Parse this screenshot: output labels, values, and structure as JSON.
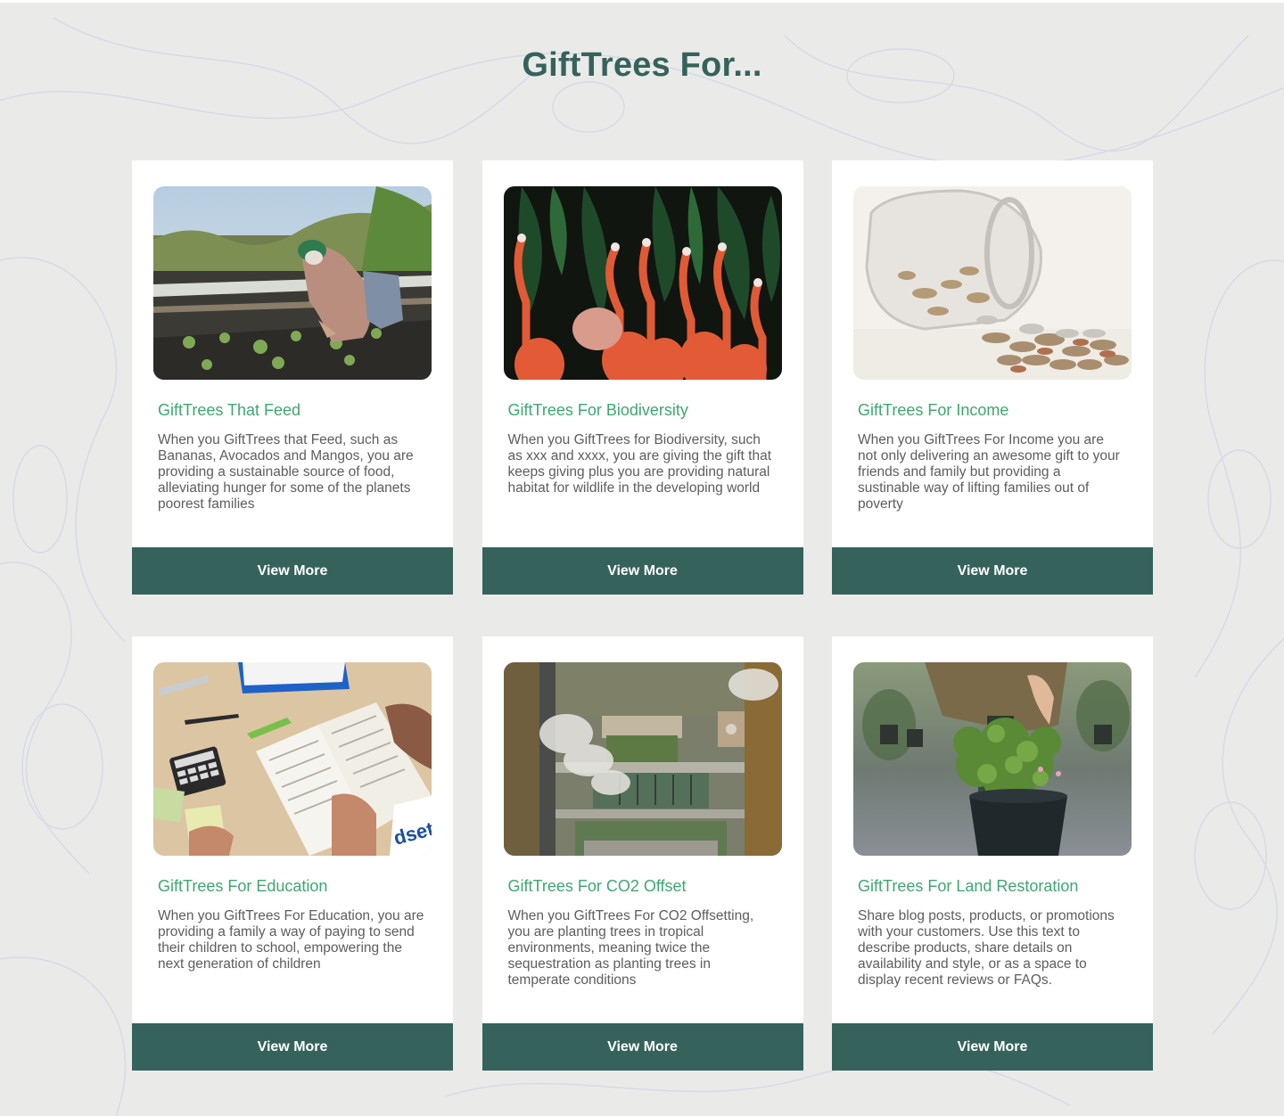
{
  "page": {
    "title": "GiftTrees For..."
  },
  "colors": {
    "background": "#eaeae8",
    "heading": "#35635c",
    "card_title": "#3fa670",
    "body_text": "#5d5d5d",
    "button": "#35635c",
    "button_text": "#ffffff"
  },
  "cards": [
    {
      "title": "GiftTrees That Feed",
      "description": "When you GiftTrees that Feed, such as Bananas, Avocados and Mangos, you are providing a sustainable source of food, alleviating hunger for some of the planets poorest families",
      "button_label": "View More",
      "image": "farmer-planting-photo"
    },
    {
      "title": "GiftTrees For Biodiversity",
      "description": "When you GiftTrees for Biodiversity, such as xxx and xxxx, you are giving the gift that keeps giving plus you are providing natural habitat for wildlife in the developing world",
      "button_label": "View More",
      "image": "flamingos-photo"
    },
    {
      "title": "GiftTrees For Income",
      "description": "When you GiftTrees For Income you are not only delivering an awesome gift to your friends and family but providing a sustinable way of lifting families out of poverty",
      "button_label": "View More",
      "image": "coin-jar-photo"
    },
    {
      "title": "GiftTrees For Education",
      "description": "When you GiftTrees For Education, you are providing a family a way of paying to send their children to school, empowering the next generation of children",
      "button_label": "View More",
      "image": "study-desk-photo"
    },
    {
      "title": "GiftTrees For CO2 Offset",
      "description": "When you GiftTrees For CO2 Offsetting, you are planting trees in tropical environments, meaning twice the sequestration as planting trees in temperate conditions",
      "button_label": "View More",
      "image": "factory-aerial-photo"
    },
    {
      "title": "GiftTrees For Land Restoration",
      "description": "Share blog posts, products, or promotions with your customers. Use this text to describe products, share details on availability and style, or as a space to display recent reviews or FAQs.",
      "button_label": "View More",
      "image": "potted-plant-photo"
    }
  ]
}
